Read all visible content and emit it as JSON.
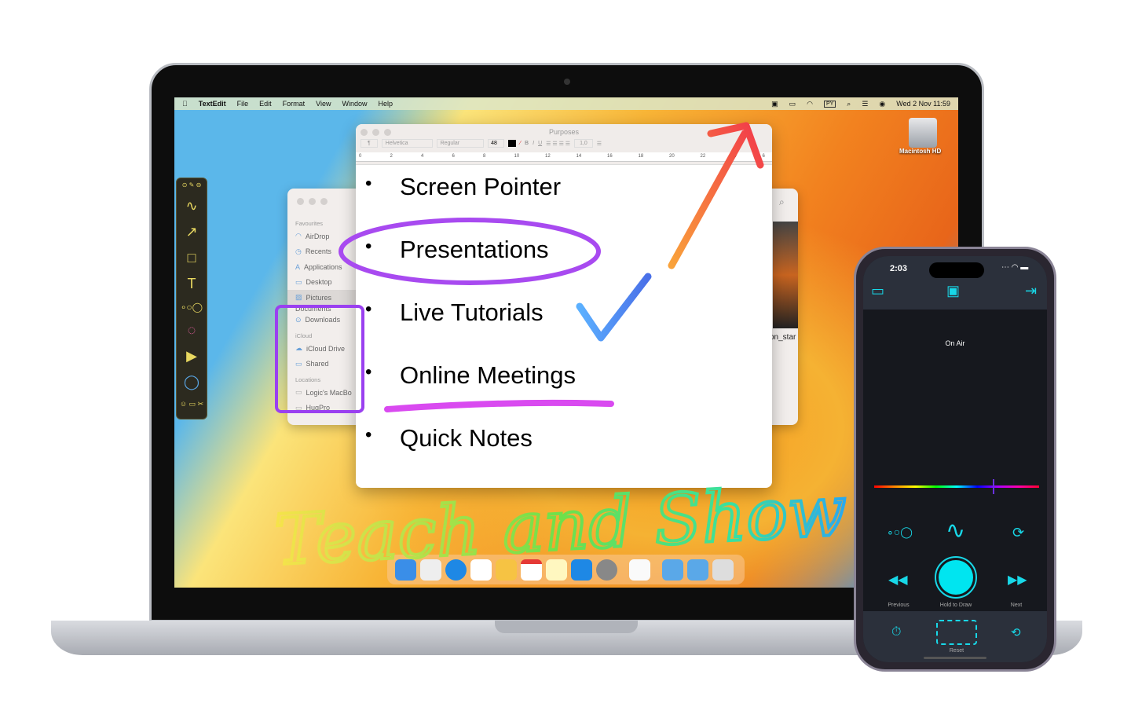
{
  "menubar": {
    "app": "TextEdit",
    "items": [
      "File",
      "Edit",
      "Format",
      "View",
      "Window",
      "Help"
    ],
    "input_source": "PY",
    "clock": "Wed 2 Nov  11:59"
  },
  "desktop": {
    "drive_label": "Macintosh HD"
  },
  "finder": {
    "sections": [
      {
        "title": "Favourites",
        "items": [
          "AirDrop",
          "Recents",
          "Applications",
          "Desktop",
          "Pictures",
          "Documents",
          "Downloads"
        ]
      },
      {
        "title": "iCloud",
        "items": [
          "iCloud Drive",
          "Shared"
        ]
      },
      {
        "title": "Locations",
        "items": [
          "Logic's MacBo",
          "HugPro"
        ]
      }
    ],
    "selected": "Pictures",
    "partial_filename": "on_star"
  },
  "textedit": {
    "title": "Purposes",
    "paragraph_style": "¶",
    "font": "Helvetica",
    "weight": "Regular",
    "size": "48",
    "line_spacing": "1,0",
    "ruler": [
      "0",
      "2",
      "4",
      "6",
      "8",
      "10",
      "12",
      "14",
      "16",
      "18",
      "20",
      "22",
      "24",
      "6"
    ],
    "bullets": [
      "Screen Pointer",
      "Presentations",
      "Live Tutorials",
      "Online Meetings",
      "Quick Notes"
    ]
  },
  "annotation": {
    "handwriting": "Teach and Show"
  },
  "phone": {
    "time": "2:03",
    "status": "On Air",
    "previous": "Previous",
    "hold": "Hold to Draw",
    "next": "Next",
    "reset": "Reset",
    "color_slider_value": 0.72,
    "accent": "#18d8e8"
  }
}
